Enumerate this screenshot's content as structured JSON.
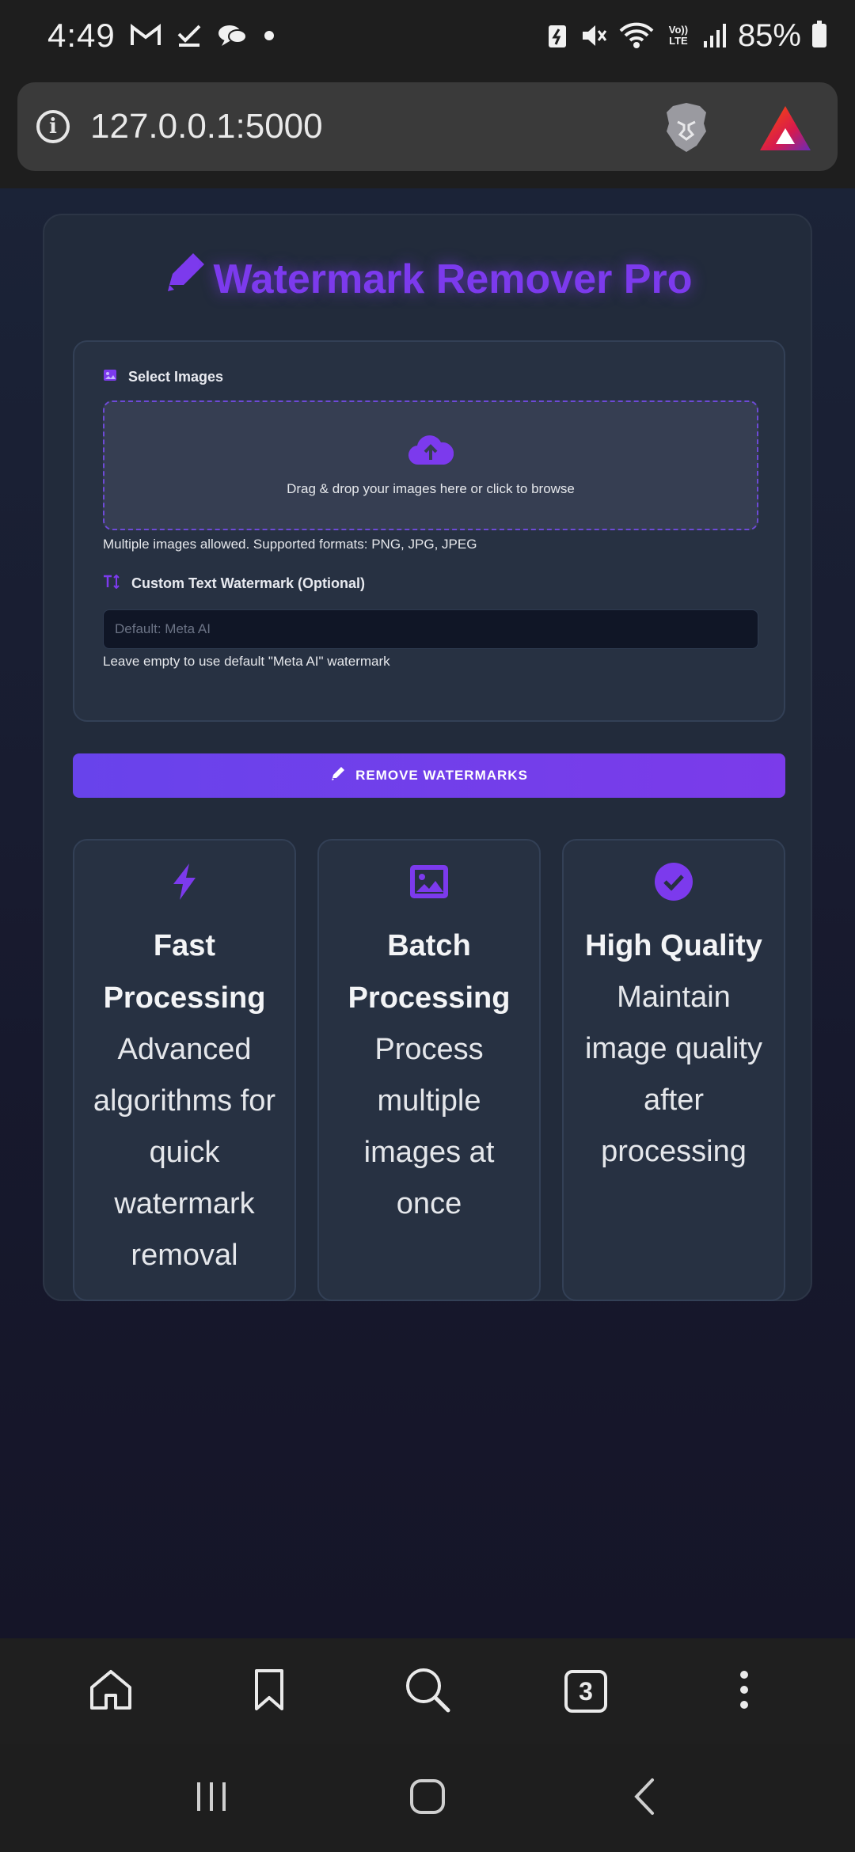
{
  "status_bar": {
    "time": "4:49",
    "battery": "85%",
    "volte": "Vo)) LTE"
  },
  "browser": {
    "url": "127.0.0.1:5000"
  },
  "app": {
    "title": "Watermark Remover Pro",
    "select_images_label": "Select Images",
    "dropzone_text": "Drag & drop your images here or click to browse",
    "formats_hint": "Multiple images allowed. Supported formats: PNG, JPG, JPEG",
    "custom_text_label": "Custom Text Watermark (Optional)",
    "custom_text_placeholder": "Default: Meta AI",
    "custom_text_hint": "Leave empty to use default \"Meta AI\" watermark",
    "remove_button": "REMOVE WATERMARKS",
    "accent_color": "#7c3aed"
  },
  "features": [
    {
      "icon": "bolt-icon",
      "title": "Fast Processing",
      "description": "Advanced algorithms for quick watermark removal"
    },
    {
      "icon": "image-icon",
      "title": "Batch Processing",
      "description": "Process multiple images at once"
    },
    {
      "icon": "check-circle-icon",
      "title": "High Quality",
      "description": "Maintain image quality after processing"
    }
  ],
  "bottom_nav": {
    "tab_count": "3"
  }
}
